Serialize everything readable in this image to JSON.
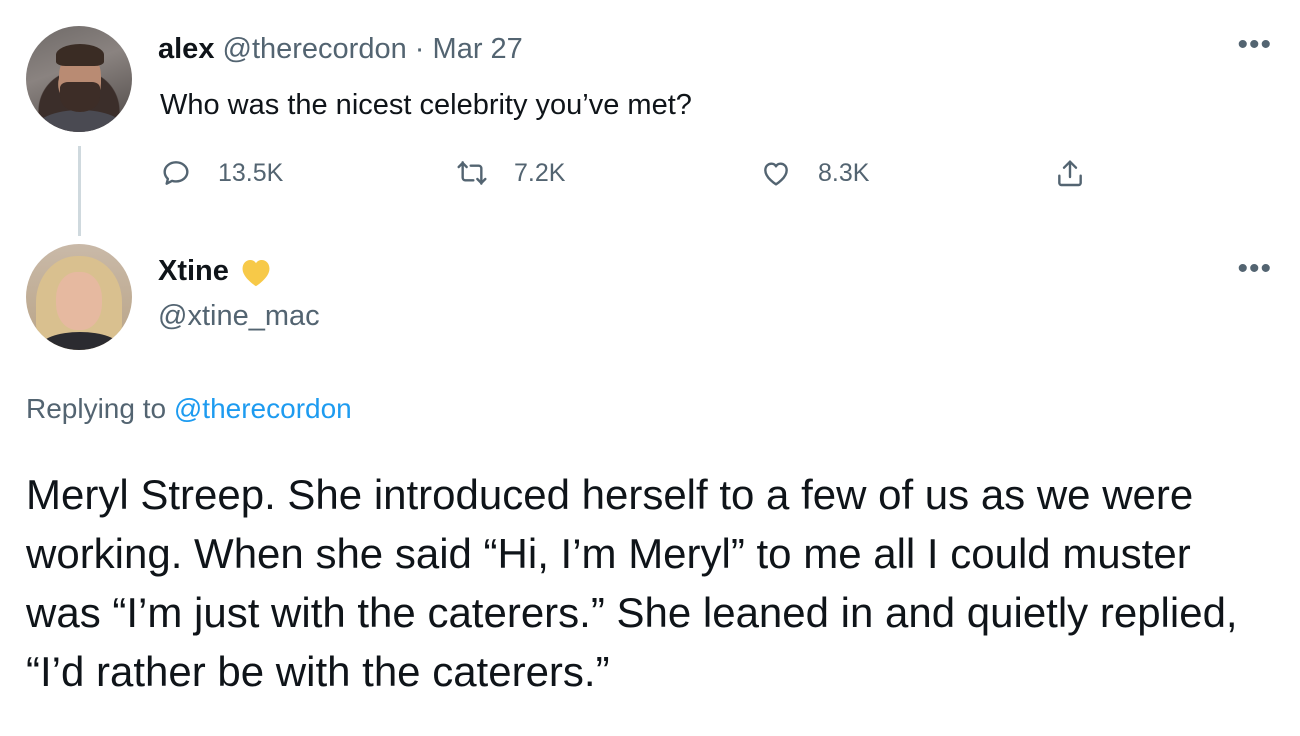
{
  "tweet": {
    "author_name": "alex",
    "author_handle": "@therecordon",
    "separator": "·",
    "date": "Mar 27",
    "text": "Who was the nicest celebrity you’ve met?",
    "more_glyph": "•••",
    "actions": {
      "replies": "13.5K",
      "retweets": "7.2K",
      "likes": "8.3K"
    }
  },
  "reply": {
    "author_name": "Xtine",
    "author_handle": "@xtine_mac",
    "more_glyph": "•••",
    "replying_prefix": "Replying to",
    "replying_to": "@therecordon",
    "text": "Meryl Streep. She introduced herself to a few of us as we were working. When she said “Hi, I’m Meryl” to me all I could muster was “I’m just with the caterers.” She leaned in and quietly replied, “I’d rather be with the caterers.”"
  },
  "colors": {
    "text": "#0f1419",
    "muted": "#536471",
    "link": "#1d9bf0",
    "heart_emoji": "#f7c948",
    "thread_line": "#cfd9de"
  },
  "icons": [
    "reply-icon",
    "retweet-icon",
    "like-icon",
    "share-icon",
    "more-icon",
    "yellow-heart-icon"
  ]
}
